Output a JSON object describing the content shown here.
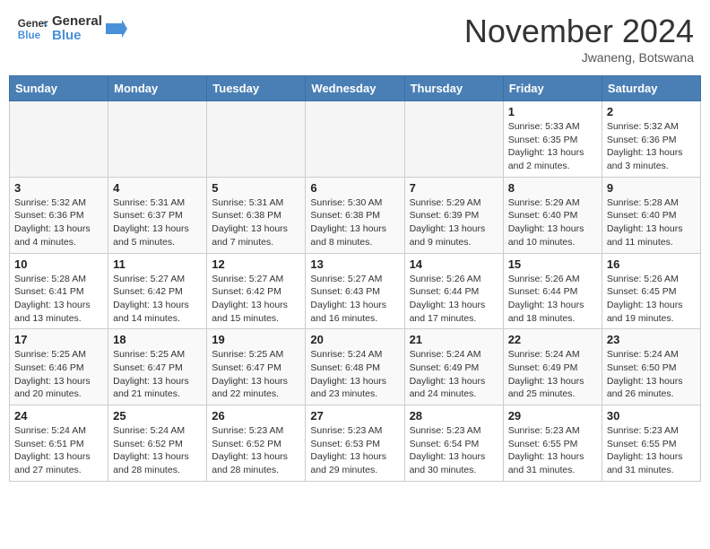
{
  "header": {
    "logo_line1": "General",
    "logo_line2": "Blue",
    "month_title": "November 2024",
    "location": "Jwaneng, Botswana"
  },
  "weekdays": [
    "Sunday",
    "Monday",
    "Tuesday",
    "Wednesday",
    "Thursday",
    "Friday",
    "Saturday"
  ],
  "weeks": [
    [
      {
        "day": "",
        "info": ""
      },
      {
        "day": "",
        "info": ""
      },
      {
        "day": "",
        "info": ""
      },
      {
        "day": "",
        "info": ""
      },
      {
        "day": "",
        "info": ""
      },
      {
        "day": "1",
        "info": "Sunrise: 5:33 AM\nSunset: 6:35 PM\nDaylight: 13 hours and 2 minutes."
      },
      {
        "day": "2",
        "info": "Sunrise: 5:32 AM\nSunset: 6:36 PM\nDaylight: 13 hours and 3 minutes."
      }
    ],
    [
      {
        "day": "3",
        "info": "Sunrise: 5:32 AM\nSunset: 6:36 PM\nDaylight: 13 hours and 4 minutes."
      },
      {
        "day": "4",
        "info": "Sunrise: 5:31 AM\nSunset: 6:37 PM\nDaylight: 13 hours and 5 minutes."
      },
      {
        "day": "5",
        "info": "Sunrise: 5:31 AM\nSunset: 6:38 PM\nDaylight: 13 hours and 7 minutes."
      },
      {
        "day": "6",
        "info": "Sunrise: 5:30 AM\nSunset: 6:38 PM\nDaylight: 13 hours and 8 minutes."
      },
      {
        "day": "7",
        "info": "Sunrise: 5:29 AM\nSunset: 6:39 PM\nDaylight: 13 hours and 9 minutes."
      },
      {
        "day": "8",
        "info": "Sunrise: 5:29 AM\nSunset: 6:40 PM\nDaylight: 13 hours and 10 minutes."
      },
      {
        "day": "9",
        "info": "Sunrise: 5:28 AM\nSunset: 6:40 PM\nDaylight: 13 hours and 11 minutes."
      }
    ],
    [
      {
        "day": "10",
        "info": "Sunrise: 5:28 AM\nSunset: 6:41 PM\nDaylight: 13 hours and 13 minutes."
      },
      {
        "day": "11",
        "info": "Sunrise: 5:27 AM\nSunset: 6:42 PM\nDaylight: 13 hours and 14 minutes."
      },
      {
        "day": "12",
        "info": "Sunrise: 5:27 AM\nSunset: 6:42 PM\nDaylight: 13 hours and 15 minutes."
      },
      {
        "day": "13",
        "info": "Sunrise: 5:27 AM\nSunset: 6:43 PM\nDaylight: 13 hours and 16 minutes."
      },
      {
        "day": "14",
        "info": "Sunrise: 5:26 AM\nSunset: 6:44 PM\nDaylight: 13 hours and 17 minutes."
      },
      {
        "day": "15",
        "info": "Sunrise: 5:26 AM\nSunset: 6:44 PM\nDaylight: 13 hours and 18 minutes."
      },
      {
        "day": "16",
        "info": "Sunrise: 5:26 AM\nSunset: 6:45 PM\nDaylight: 13 hours and 19 minutes."
      }
    ],
    [
      {
        "day": "17",
        "info": "Sunrise: 5:25 AM\nSunset: 6:46 PM\nDaylight: 13 hours and 20 minutes."
      },
      {
        "day": "18",
        "info": "Sunrise: 5:25 AM\nSunset: 6:47 PM\nDaylight: 13 hours and 21 minutes."
      },
      {
        "day": "19",
        "info": "Sunrise: 5:25 AM\nSunset: 6:47 PM\nDaylight: 13 hours and 22 minutes."
      },
      {
        "day": "20",
        "info": "Sunrise: 5:24 AM\nSunset: 6:48 PM\nDaylight: 13 hours and 23 minutes."
      },
      {
        "day": "21",
        "info": "Sunrise: 5:24 AM\nSunset: 6:49 PM\nDaylight: 13 hours and 24 minutes."
      },
      {
        "day": "22",
        "info": "Sunrise: 5:24 AM\nSunset: 6:49 PM\nDaylight: 13 hours and 25 minutes."
      },
      {
        "day": "23",
        "info": "Sunrise: 5:24 AM\nSunset: 6:50 PM\nDaylight: 13 hours and 26 minutes."
      }
    ],
    [
      {
        "day": "24",
        "info": "Sunrise: 5:24 AM\nSunset: 6:51 PM\nDaylight: 13 hours and 27 minutes."
      },
      {
        "day": "25",
        "info": "Sunrise: 5:24 AM\nSunset: 6:52 PM\nDaylight: 13 hours and 28 minutes."
      },
      {
        "day": "26",
        "info": "Sunrise: 5:23 AM\nSunset: 6:52 PM\nDaylight: 13 hours and 28 minutes."
      },
      {
        "day": "27",
        "info": "Sunrise: 5:23 AM\nSunset: 6:53 PM\nDaylight: 13 hours and 29 minutes."
      },
      {
        "day": "28",
        "info": "Sunrise: 5:23 AM\nSunset: 6:54 PM\nDaylight: 13 hours and 30 minutes."
      },
      {
        "day": "29",
        "info": "Sunrise: 5:23 AM\nSunset: 6:55 PM\nDaylight: 13 hours and 31 minutes."
      },
      {
        "day": "30",
        "info": "Sunrise: 5:23 AM\nSunset: 6:55 PM\nDaylight: 13 hours and 31 minutes."
      }
    ]
  ]
}
